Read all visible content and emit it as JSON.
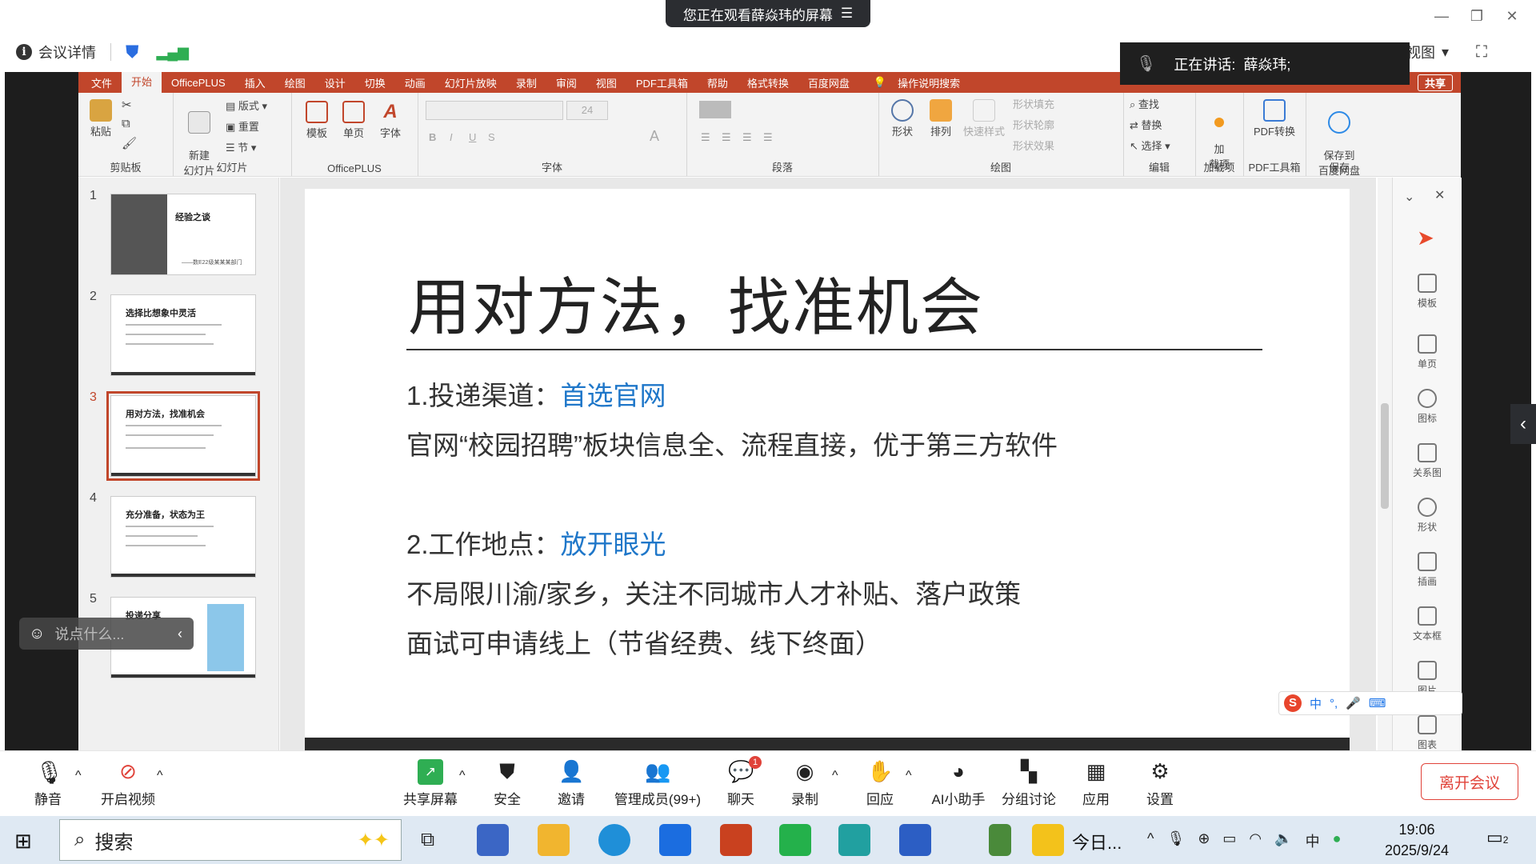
{
  "meeting": {
    "share_banner": "您正在观看薛焱玮的屏幕",
    "info_label": "会议详情",
    "speaking_label": "正在讲话:",
    "speaking_name": "薛焱玮;",
    "view_label": "者视图"
  },
  "ppt": {
    "tabs": [
      "文件",
      "开始",
      "OfficePLUS",
      "插入",
      "绘图",
      "设计",
      "切换",
      "动画",
      "幻灯片放映",
      "录制",
      "审阅",
      "视图",
      "PDF工具箱",
      "帮助",
      "格式转换",
      "百度网盘",
      "操作说明搜索"
    ],
    "active_tab": "开始",
    "share_label": "共享",
    "ribbon": {
      "clipboard": {
        "label": "剪贴板",
        "paste": "粘贴"
      },
      "slides": {
        "label": "幻灯片",
        "new": "新建\n幻灯片",
        "layout": "版式",
        "reset": "重置",
        "section": "节"
      },
      "officeplus": {
        "label": "OfficePLUS",
        "template": "模板",
        "single": "单页",
        "font": "字体"
      },
      "font_group": {
        "label": "字体",
        "size": "24"
      },
      "paragraph": {
        "label": "段落"
      },
      "drawing": {
        "label": "绘图",
        "shape": "形状",
        "arrange": "排列",
        "quick_style": "快速样式",
        "fill": "形状填充",
        "outline": "形状轮廓",
        "effect": "形状效果"
      },
      "editing": {
        "label": "编辑",
        "find": "查找",
        "replace": "替换",
        "select": "选择"
      },
      "addins": {
        "label": "加载项",
        "btn": "加\n载项"
      },
      "pdf": {
        "label": "PDF工具箱",
        "btn": "PDF转换"
      },
      "save": {
        "label": "保存",
        "btn": "保存到\n百度网盘"
      }
    },
    "thumbnails": [
      {
        "num": "1",
        "title": "经验之谈",
        "sub": "——数E22级某某某部门"
      },
      {
        "num": "2",
        "title": "选择比想象中灵活"
      },
      {
        "num": "3",
        "title": "用对方法，找准机会"
      },
      {
        "num": "4",
        "title": "充分准备，状态为王"
      },
      {
        "num": "5",
        "title": "投递分享"
      }
    ],
    "active_slide": 3,
    "slide": {
      "title": "用对方法，找准机会",
      "line1_prefix": "1.投递渠道：",
      "line1_highlight": "首选官网",
      "line2": "官网“校园招聘”板块信息全、流程直接，优于第三方软件",
      "line3_prefix": "2.工作地点：",
      "line3_highlight": "放开眼光",
      "line4": "不局限川渝/家乡，关注不同城市人才补贴、落户政策",
      "line5": "面试可申请线上（节省经费、线下终面）"
    },
    "right_panel": [
      "模板",
      "单页",
      "图标",
      "关系图",
      "形状",
      "插画",
      "文本框",
      "图片",
      "图表"
    ],
    "chat_placeholder": "说点什么..."
  },
  "toolbar": {
    "mute": "静音",
    "video": "开启视频",
    "share": "共享屏幕",
    "security": "安全",
    "invite": "邀请",
    "members": "管理成员(99+)",
    "chat": "聊天",
    "chat_badge": "1",
    "record": "录制",
    "react": "回应",
    "ai": "AI小助手",
    "breakout": "分组讨论",
    "apps": "应用",
    "settings": "设置",
    "leave": "离开会议"
  },
  "taskbar": {
    "search": "搜索",
    "news": "今日...",
    "time": "19:06",
    "date": "2025/9/24",
    "notif": "2",
    "ime": "中"
  },
  "colors": {
    "ppt_accent": "#c1462b",
    "highlight": "#1f77c9",
    "leave": "#e0433a"
  }
}
